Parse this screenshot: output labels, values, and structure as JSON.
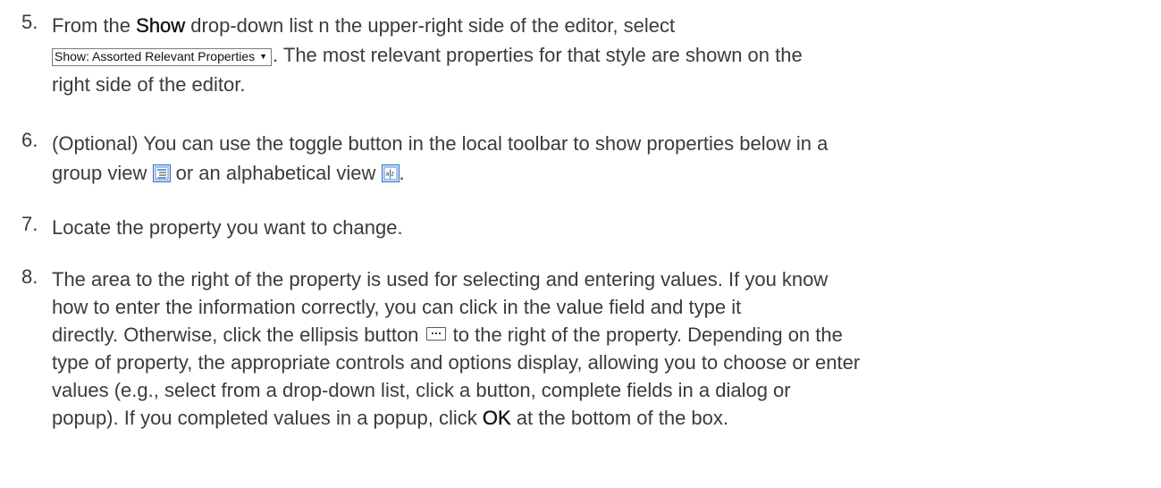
{
  "steps": [
    {
      "number": "5.",
      "line1_pre": "From the ",
      "line1_bold": "Show",
      "line1_post": " drop-down list  n the upper-right side of the editor, select",
      "dropdown_label": "Show: Assorted Relevant Properties",
      "line2_post": ". The most relevant properties for that style are shown on the",
      "line3": "right side of the editor."
    },
    {
      "number": "6.",
      "line1": "(Optional) You can use the toggle button in the local toolbar to show properties below in a",
      "line2_pre": "group view ",
      "line2_mid": " or an alphabetical view ",
      "line2_post": ".",
      "group_icon": "group-view-icon",
      "alpha_icon": "alphabetical-view-icon"
    },
    {
      "number": "7.",
      "line1": "Locate the property you want to change."
    },
    {
      "number": "8.",
      "line1": "The area to the right of the property is used for selecting and entering values. If you know",
      "line2": "how to enter the information correctly, you can click in the value field and type it",
      "line3_pre": "directly. Otherwise, click the ellipsis button ",
      "line3_post": " to the right of the property. Depending on the",
      "line4": "type of property, the appropriate controls and options display, allowing you to choose or enter",
      "line5": "values (e.g., select from a drop-down list, click a button, complete fields in a dialog or",
      "line6_pre": "popup). If you completed values in a popup, click ",
      "line6_bold": "OK",
      "line6_post": " at the bottom of the box.",
      "ellipsis_icon": "ellipsis-button-icon"
    }
  ],
  "colors": {
    "text": "#3b3b3b",
    "emphasis": "#111111",
    "icon_blue": "#2f6fbf"
  }
}
